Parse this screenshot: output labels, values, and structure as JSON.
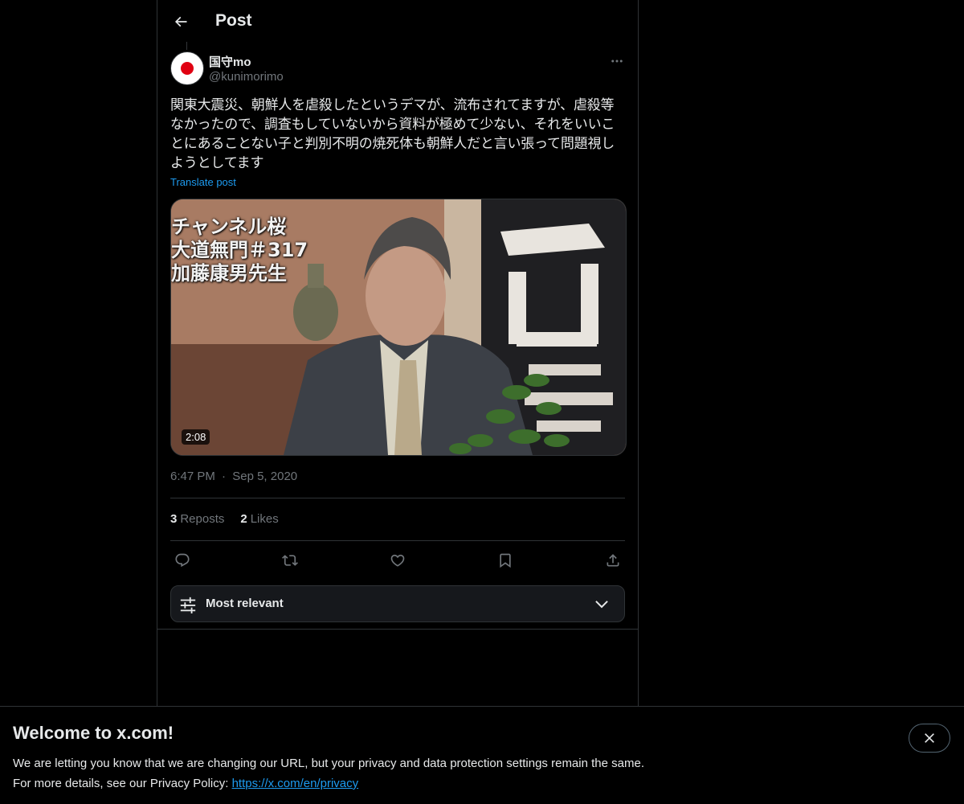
{
  "header": {
    "title": "Post",
    "back_icon": "arrow-left-icon"
  },
  "post": {
    "author": {
      "display_name": "国守mo",
      "handle": "@kunimorimo",
      "avatar_colors": {
        "background": "#ffffff",
        "sun": "#e00012"
      }
    },
    "text": "関東大震災、朝鮮人を虐殺したというデマが、流布されてますが、虐殺等なかったので、調査もしていないから資料が極めて少ない、それをいいことにあることない子と判別不明の焼死体も朝鮮人だと言い張って問題視しようとしてます",
    "translate_label": "Translate post",
    "media": {
      "caption_lines": [
        "チャンネル桜",
        "大道無門＃317",
        "加藤康男先生"
      ],
      "duration": "2:08"
    },
    "time": "6:47 PM",
    "separator": "·",
    "date": "Sep 5, 2020",
    "stats": {
      "reposts_count": "3",
      "reposts_label": "Reposts",
      "likes_count": "2",
      "likes_label": "Likes"
    },
    "actions": [
      "reply-icon",
      "repost-icon",
      "like-icon",
      "bookmark-icon",
      "share-icon"
    ]
  },
  "sort": {
    "label": "Most relevant",
    "icon": "sliders-icon",
    "chevron": "chevron-down-icon"
  },
  "banner": {
    "title": "Welcome to x.com!",
    "line1": "We are letting you know that we are changing our URL, but your privacy and data protection settings remain the same.",
    "line2_prefix": "For more details, see our Privacy Policy: ",
    "link_text": "https://x.com/en/privacy",
    "close_icon": "close-icon"
  },
  "colors": {
    "background": "#000000",
    "text": "#e7e9ea",
    "muted": "#71767b",
    "accent": "#1d9bf0",
    "border": "#2f3336"
  }
}
